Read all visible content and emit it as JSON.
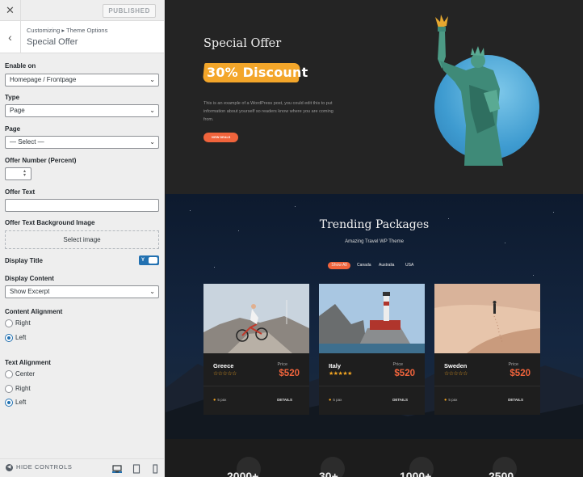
{
  "topbar": {
    "close_icon": "close-icon",
    "published_label": "PUBLISHED"
  },
  "section": {
    "breadcrumb": "Customizing ▸ Theme Options",
    "title": "Special Offer"
  },
  "controls": {
    "enable_on": {
      "label": "Enable on",
      "value": "Homepage / Frontpage"
    },
    "type": {
      "label": "Type",
      "value": "Page"
    },
    "page": {
      "label": "Page",
      "value": "— Select —"
    },
    "offer_number": {
      "label": "Offer Number (Percent)",
      "value": ""
    },
    "offer_text": {
      "label": "Offer Text",
      "value": ""
    },
    "offer_bg_image": {
      "label": "Offer Text Background Image",
      "button": "Select image"
    },
    "display_title": {
      "label": "Display Title",
      "toggle_text": "Y",
      "on": true
    },
    "display_content": {
      "label": "Display Content",
      "value": "Show Excerpt"
    },
    "content_alignment": {
      "label": "Content Alignment",
      "options": [
        "Right",
        "Left"
      ],
      "selected": "Left"
    },
    "text_alignment": {
      "label": "Text Alignment",
      "options": [
        "Center",
        "Right",
        "Left"
      ],
      "selected": "Left"
    }
  },
  "footer": {
    "hide_controls": "HIDE CONTROLS",
    "devices": [
      "desktop-icon",
      "tablet-icon",
      "mobile-icon"
    ],
    "active_device": "desktop"
  },
  "preview": {
    "offer": {
      "title": "Special Offer",
      "discount": "30% Discount",
      "description": "This is an example of a WordPress post, you could edit this to put information about yourself so readers know where you are coming from.",
      "button": "VIEW DEALS"
    },
    "trending": {
      "title": "Trending Packages",
      "subtitle": "Amazing Travel WP Theme",
      "filters": [
        "Show All",
        "Canada",
        "Australia",
        "USA"
      ],
      "active_filter": "Show All",
      "cards": [
        {
          "name": "Greece",
          "price_label": "Price",
          "price": "$520",
          "rating": 0,
          "pax": "5 pax",
          "details": "DETAILS"
        },
        {
          "name": "Italy",
          "price_label": "Price",
          "price": "$520",
          "rating": 5,
          "pax": "5 pax",
          "details": "DETAILS"
        },
        {
          "name": "Sweden",
          "price_label": "Price",
          "price": "$520",
          "rating": 0,
          "pax": "5 pax",
          "details": "DETAILS"
        }
      ]
    },
    "stats": [
      "2000+",
      "30+",
      "1000+",
      "2500"
    ]
  },
  "colors": {
    "accent": "#f0643c",
    "discount_bg": "#f3a62a",
    "wp_blue": "#2271b1",
    "star": "#f4a623"
  }
}
